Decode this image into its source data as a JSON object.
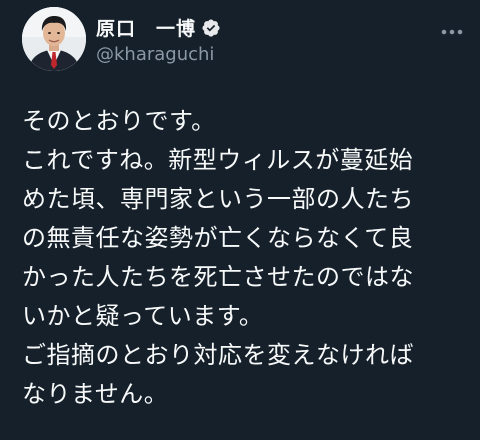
{
  "author": {
    "display_name": "原口　一博",
    "handle": "@kharaguchi",
    "verified": true,
    "verified_color": "#1d9bf0"
  },
  "tweet": {
    "lines": [
      "そのとおりです。",
      "これですね。新型ウィルスが蔓延始",
      "めた頃、専門家という一部の人たち",
      "の無責任な姿勢が亡くならなくて良",
      "かった人たちを死亡させたのではな",
      "いかと疑っています。",
      "ご指摘のとおり対応を変えなければ",
      "なりません。"
    ]
  },
  "icons": {
    "verified": "verified-badge-icon",
    "more": "more-options-icon"
  },
  "colors": {
    "background": "#15202b",
    "text": "#f7f9f9",
    "secondary_text": "#8b98a5"
  }
}
